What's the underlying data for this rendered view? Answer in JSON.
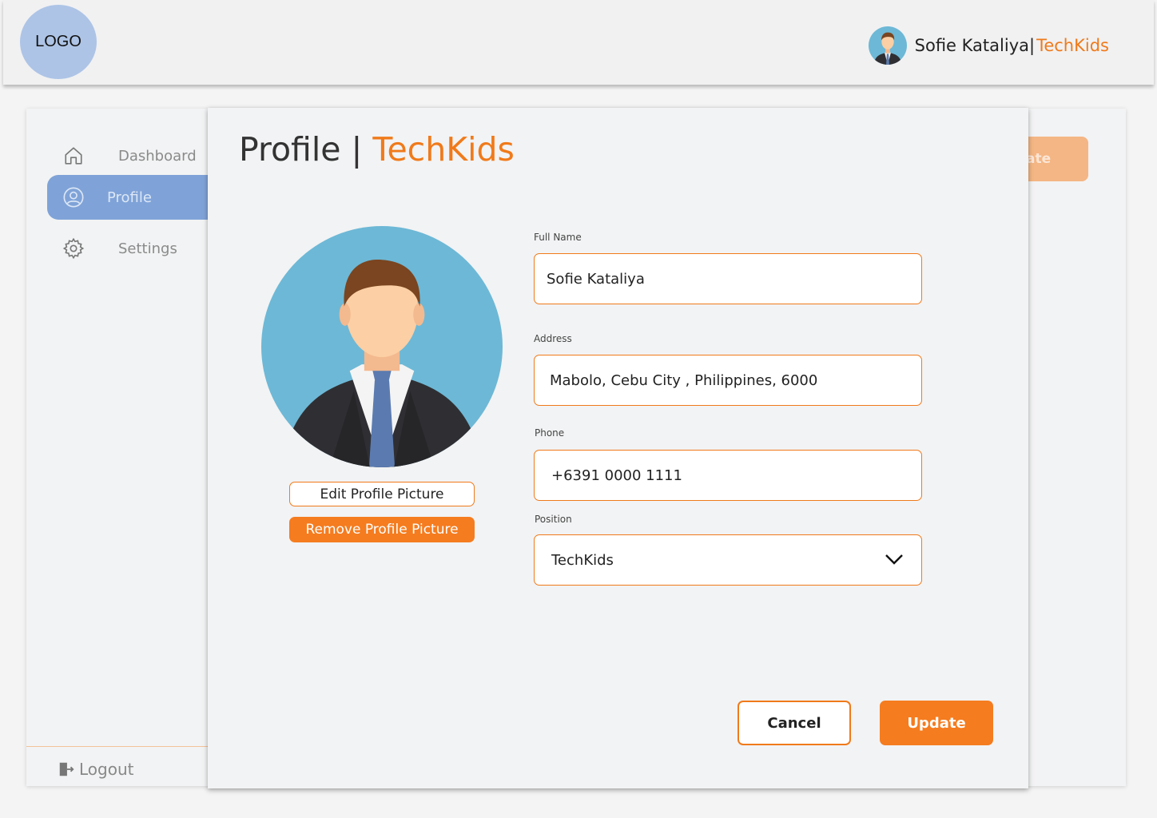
{
  "header": {
    "logo": "LOGO",
    "user_name": "Sofie Kataliya",
    "separator": "|",
    "org": "TechKids"
  },
  "sidebar": {
    "items": [
      {
        "label": "Dashboard",
        "icon": "home-icon"
      },
      {
        "label": "Profile",
        "icon": "user-circle-icon",
        "active": true
      },
      {
        "label": "Settings",
        "icon": "gear-icon"
      }
    ],
    "logout": "Logout"
  },
  "background": {
    "update_partial": "ate"
  },
  "modal": {
    "title": "Profile | ",
    "title_org": "TechKids",
    "edit_picture": "Edit Profile Picture",
    "remove_picture": "Remove Profile Picture",
    "fields": {
      "full_name": {
        "label": "Full Name",
        "value": "Sofie Kataliya"
      },
      "address": {
        "label": "Address",
        "value": "Mabolo, Cebu City , Philippines, 6000"
      },
      "phone": {
        "label": "Phone",
        "value": "+6391 0000 1111"
      },
      "position": {
        "label": "Position",
        "value": "TechKids"
      }
    },
    "cancel": "Cancel",
    "update": "Update"
  },
  "colors": {
    "accent": "#f57c1f",
    "sidebar_active": "#7fa3d8",
    "logo_bg": "#adc4e6"
  }
}
